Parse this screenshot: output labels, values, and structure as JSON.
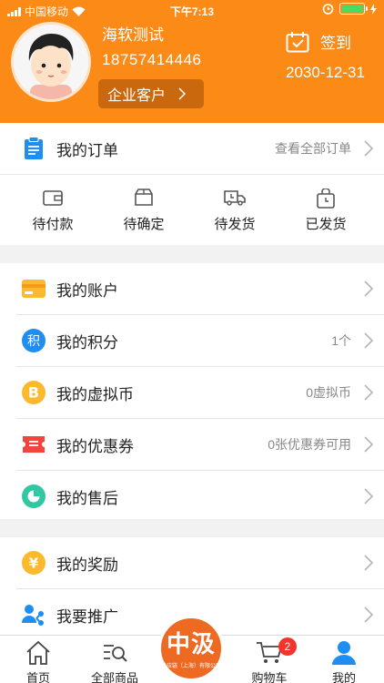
{
  "status_bar": {
    "carrier": "中国移动",
    "time": "下午7:13"
  },
  "profile": {
    "name": "海软测试",
    "phone": "18757414446",
    "customer_type": "企业客户",
    "checkin_label": "签到",
    "checkin_date": "2030-12-31"
  },
  "orders": {
    "title": "我的订单",
    "view_all": "查看全部订单",
    "statuses": [
      {
        "label": "待付款",
        "icon": "wallet-icon"
      },
      {
        "label": "待确定",
        "icon": "box-icon"
      },
      {
        "label": "待发货",
        "icon": "truck-icon"
      },
      {
        "label": "已发货",
        "icon": "shipped-bag-icon"
      }
    ]
  },
  "menu1": [
    {
      "label": "我的账户",
      "value": "",
      "icon": "card-icon"
    },
    {
      "label": "我的积分",
      "value": "1个",
      "icon": "points-icon"
    },
    {
      "label": "我的虚拟币",
      "value": "0虚拟币",
      "icon": "coin-b-icon"
    },
    {
      "label": "我的优惠券",
      "value": "0张优惠券可用",
      "icon": "coupon-icon"
    },
    {
      "label": "我的售后",
      "value": "",
      "icon": "after-sales-icon"
    }
  ],
  "menu2": [
    {
      "label": "我的奖励",
      "value": "",
      "icon": "yen-reward-icon"
    },
    {
      "label": "我要推广",
      "value": "",
      "icon": "share-users-icon"
    }
  ],
  "tabbar": {
    "home": "首页",
    "all_products": "全部商品",
    "logo_text": "中汲",
    "logo_sub": "供应链（上海）有限公司",
    "cart": "购物车",
    "cart_badge": "2",
    "mine": "我的"
  },
  "colors": {
    "header_orange": "#fb8a17",
    "active_blue": "#1e8ef0"
  }
}
